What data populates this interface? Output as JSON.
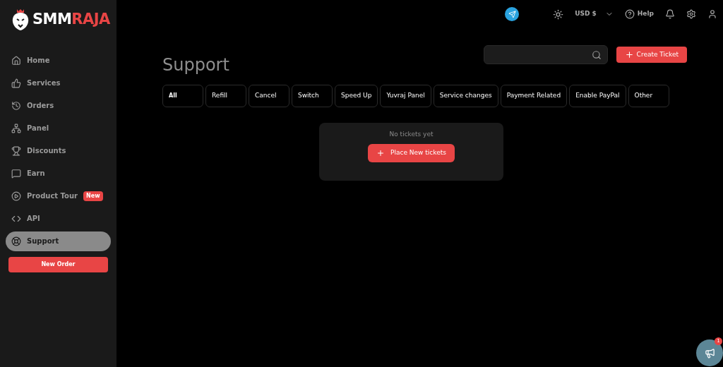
{
  "logo": {
    "first": "SMM",
    "second": "RAJA"
  },
  "sidebar": {
    "items": [
      {
        "kind": "home",
        "label": "Home",
        "selected": false
      },
      {
        "kind": "services",
        "label": "Services",
        "selected": false
      },
      {
        "kind": "orders",
        "label": "Orders",
        "selected": false
      },
      {
        "kind": "panel",
        "label": "Panel",
        "selected": false
      },
      {
        "kind": "discounts",
        "label": "Discounts",
        "selected": false
      },
      {
        "kind": "earn",
        "label": "Earn",
        "selected": false
      },
      {
        "kind": "tour",
        "label": "Product Tour",
        "selected": false,
        "badge": "New"
      },
      {
        "kind": "api",
        "label": "API",
        "selected": false
      },
      {
        "kind": "support",
        "label": "Support",
        "selected": true
      }
    ],
    "new_order": "New Order"
  },
  "topbar": {
    "currency": "USD $",
    "help": "Help"
  },
  "page": {
    "title": "Support",
    "create_ticket": "Create Ticket",
    "filters": [
      {
        "label": "All",
        "selected": true
      },
      {
        "label": "Refill",
        "selected": false
      },
      {
        "label": "Cancel",
        "selected": false
      },
      {
        "label": "Switch",
        "selected": false
      },
      {
        "label": "Speed Up",
        "selected": false
      },
      {
        "label": "Yuvraj Panel",
        "selected": false
      },
      {
        "label": "Service changes",
        "selected": false
      },
      {
        "label": "Payment Related",
        "selected": false
      },
      {
        "label": "Enable PayPal",
        "selected": false
      },
      {
        "label": "Other",
        "selected": false
      }
    ],
    "empty": {
      "message": "No tickets yet",
      "button": "Place New tickets"
    }
  },
  "announcements": {
    "count": "1"
  }
}
